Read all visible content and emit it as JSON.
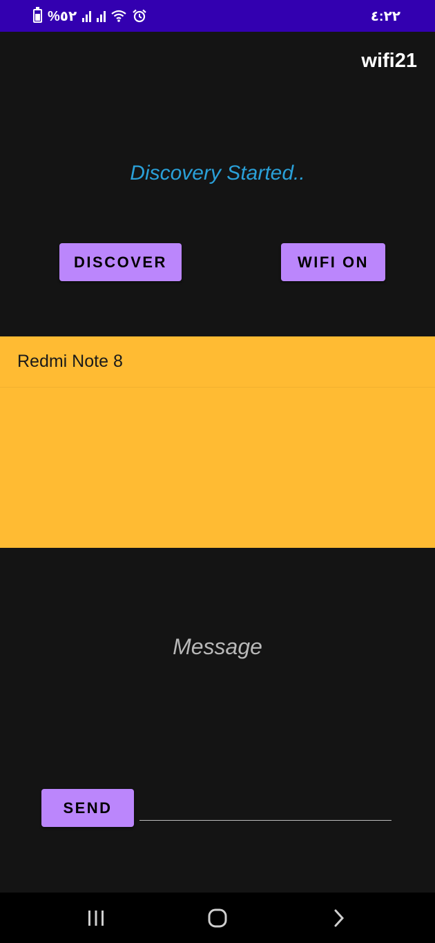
{
  "status_bar": {
    "battery_text": "%٥٢",
    "time": "٤:٢٢",
    "background": "#3300b0"
  },
  "app": {
    "title": "wifi21"
  },
  "discovery": {
    "status_text": "Discovery Started..",
    "status_color": "#2aa0d8"
  },
  "buttons": {
    "discover_label": "DISCOVER",
    "wifi_label": "WIFI ON",
    "send_label": "SEND",
    "accent": "#bb86fc"
  },
  "peers": {
    "background": "#ffbb33",
    "items": [
      {
        "name": "Redmi Note 8"
      }
    ]
  },
  "message": {
    "label": "Message",
    "input_value": "",
    "input_placeholder": ""
  },
  "nav": {
    "recents_icon": "recents-icon",
    "home_icon": "home-icon",
    "back_icon": "back-icon"
  }
}
